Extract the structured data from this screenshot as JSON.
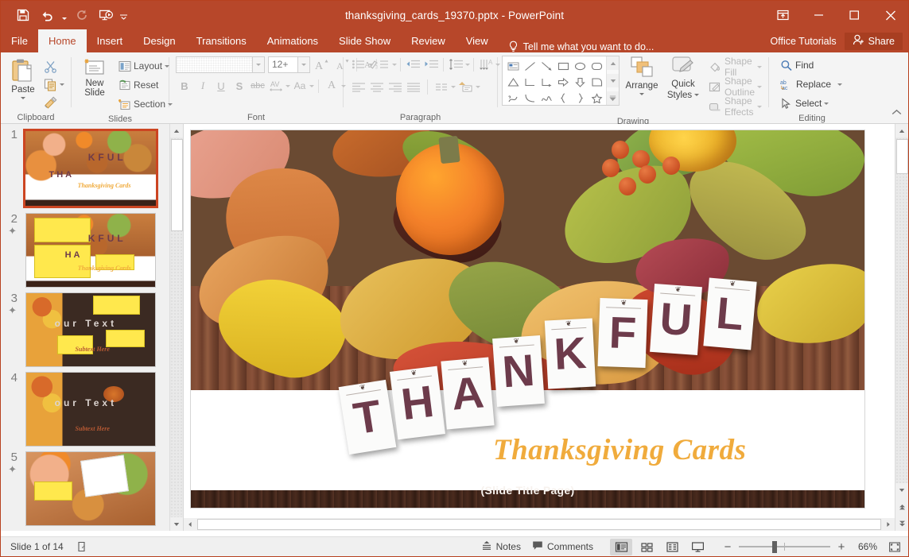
{
  "window": {
    "title": "thanksgiving_cards_19370.pptx - PowerPoint",
    "accent": "#b7472a",
    "quick_access": [
      "save-icon",
      "undo-icon",
      "redo-icon",
      "start-presentation-icon",
      "customize-qat-icon"
    ],
    "controls": [
      "ribbon-display-options-icon",
      "minimize-icon",
      "maximize-icon",
      "close-icon"
    ]
  },
  "tabs": [
    {
      "label": "File",
      "active": false
    },
    {
      "label": "Home",
      "active": true
    },
    {
      "label": "Insert",
      "active": false
    },
    {
      "label": "Design",
      "active": false
    },
    {
      "label": "Transitions",
      "active": false
    },
    {
      "label": "Animations",
      "active": false
    },
    {
      "label": "Slide Show",
      "active": false
    },
    {
      "label": "Review",
      "active": false
    },
    {
      "label": "View",
      "active": false
    }
  ],
  "tellme": {
    "placeholder": "Tell me what you want to do..."
  },
  "account": {
    "office_tutorials": "Office Tutorials",
    "share": "Share"
  },
  "ribbon": {
    "groups": [
      {
        "name": "Clipboard",
        "paste": "Paste",
        "items": [
          "Cut",
          "Copy",
          "Format Painter"
        ]
      },
      {
        "name": "Slides",
        "new_slide": "New\nSlide",
        "new_slide_line1": "New",
        "new_slide_line2": "Slide",
        "layout": "Layout",
        "reset": "Reset",
        "section": "Section"
      },
      {
        "name": "Font",
        "font_name": "",
        "font_size": "12+",
        "buttons": [
          "B",
          "I",
          "U",
          "S",
          "abc",
          "AV",
          "Aa",
          "A"
        ]
      },
      {
        "name": "Paragraph"
      },
      {
        "name": "Drawing",
        "arrange": "Arrange",
        "quick_styles_line1": "Quick",
        "quick_styles_line2": "Styles",
        "shape_fill": "Shape Fill",
        "shape_outline": "Shape Outline",
        "shape_effects": "Shape Effects"
      },
      {
        "name": "Editing",
        "find": "Find",
        "replace": "Replace",
        "select": "Select"
      }
    ]
  },
  "thumbnails": [
    {
      "number": "1",
      "selected": true,
      "animated": false
    },
    {
      "number": "2",
      "selected": false,
      "animated": true
    },
    {
      "number": "3",
      "selected": false,
      "animated": true
    },
    {
      "number": "4",
      "selected": false,
      "animated": false
    },
    {
      "number": "5",
      "selected": false,
      "animated": true
    }
  ],
  "slide": {
    "letters": [
      "T",
      "H",
      "A",
      "N",
      "K",
      "F",
      "U",
      "L"
    ],
    "title": "Thanksgiving Cards",
    "footer": "(Slide Title Page)",
    "title_color": "#f0ab3c",
    "letter_color": "#6d3b4b"
  },
  "status": {
    "slide_counter": "Slide 1 of 14",
    "language_icon": "spell-check-icon",
    "notes": "Notes",
    "comments": "Comments",
    "views": [
      "normal-view-icon",
      "slide-sorter-icon",
      "reading-view-icon",
      "slide-show-icon"
    ],
    "zoom_value": "66%",
    "zoom_minus": "−",
    "zoom_plus": "+",
    "fit_icon": "fit-slide-to-window-icon"
  }
}
